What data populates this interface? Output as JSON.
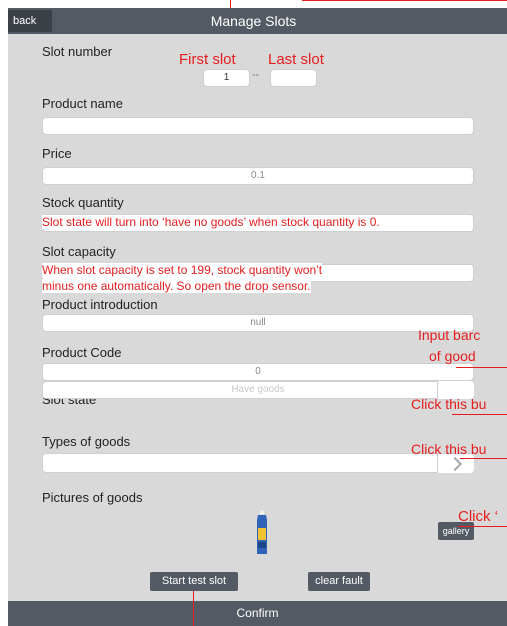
{
  "header": {
    "back_label": "back",
    "title": "Manage Slots"
  },
  "fields": {
    "slot_number": {
      "label": "Slot number",
      "first_value": "1",
      "separator": "--",
      "last_value": ""
    },
    "product_name": {
      "label": "Product name",
      "value": ""
    },
    "price": {
      "label": "Price",
      "value": "0.1"
    },
    "stock_quantity": {
      "label": "Stock quantity",
      "value": ""
    },
    "slot_capacity": {
      "label": "Slot capacity",
      "value": ""
    },
    "product_introduction": {
      "label": "Product introduction",
      "value": "null"
    },
    "product_code": {
      "label": "Product Code",
      "value": "0"
    },
    "slot_state": {
      "label": "Slot state",
      "value": "Have goods"
    },
    "types_of_goods": {
      "label": "Types of goods",
      "value": ""
    },
    "pictures_of_goods": {
      "label": "Pictures of goods"
    }
  },
  "buttons": {
    "gallery": "gallery",
    "start_test_slot": "Start test slot",
    "clear_fault": "clear fault",
    "confirm": "Confirm"
  },
  "annotations": {
    "first_slot": "First slot",
    "last_slot": "Last slot",
    "stock_note": "Slot state will turn into ‘have no goods’ when stock quantity is 0.",
    "capacity_note_1": "When slot capacity is set to 199, stock quantity won’t",
    "capacity_note_2": "minus one automatically. So open the drop sensor.",
    "barcode_1": "Input barc",
    "barcode_2": "of good",
    "click_state": "Click this bu",
    "click_types": "Click this bu",
    "click_gallery": "Click ‘"
  },
  "colors": {
    "bar": "#535a63",
    "annotation": "#e41e1e",
    "panel": "#d9d9d9"
  }
}
